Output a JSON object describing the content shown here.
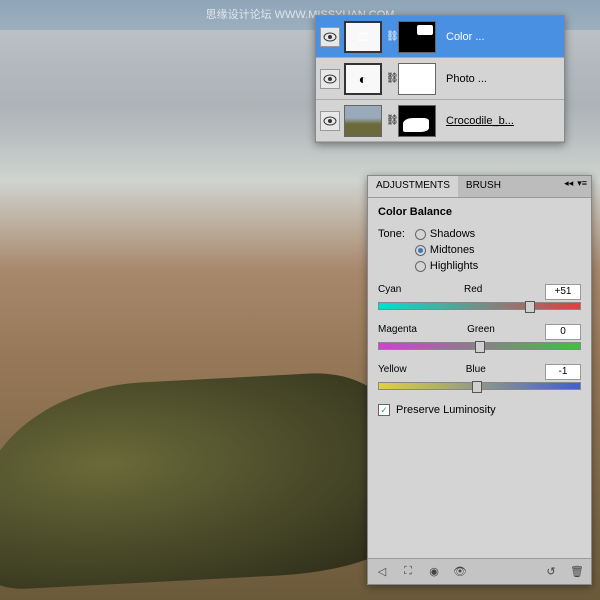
{
  "watermark": "思缘设计论坛   WWW.MISSYUAN.COM",
  "layers": {
    "items": [
      {
        "name": "Color ...",
        "adj_glyph": "⚖"
      },
      {
        "name": "Photo ...",
        "adj_glyph": "◐"
      },
      {
        "name": "Crocodile_b..."
      }
    ]
  },
  "adjustments": {
    "tabs": {
      "a": "ADJUSTMENTS",
      "b": "BRUSH"
    },
    "title": "Color Balance",
    "tone_label": "Tone:",
    "tones": {
      "shadows": "Shadows",
      "midtones": "Midtones",
      "highlights": "Highlights"
    },
    "sliders": {
      "cr": {
        "left": "Cyan",
        "right": "Red",
        "value": "+51",
        "pos": 75
      },
      "mg": {
        "left": "Magenta",
        "right": "Green",
        "value": "0",
        "pos": 50
      },
      "yb": {
        "left": "Yellow",
        "right": "Blue",
        "value": "-1",
        "pos": 49
      }
    },
    "preserve": "Preserve Luminosity"
  }
}
